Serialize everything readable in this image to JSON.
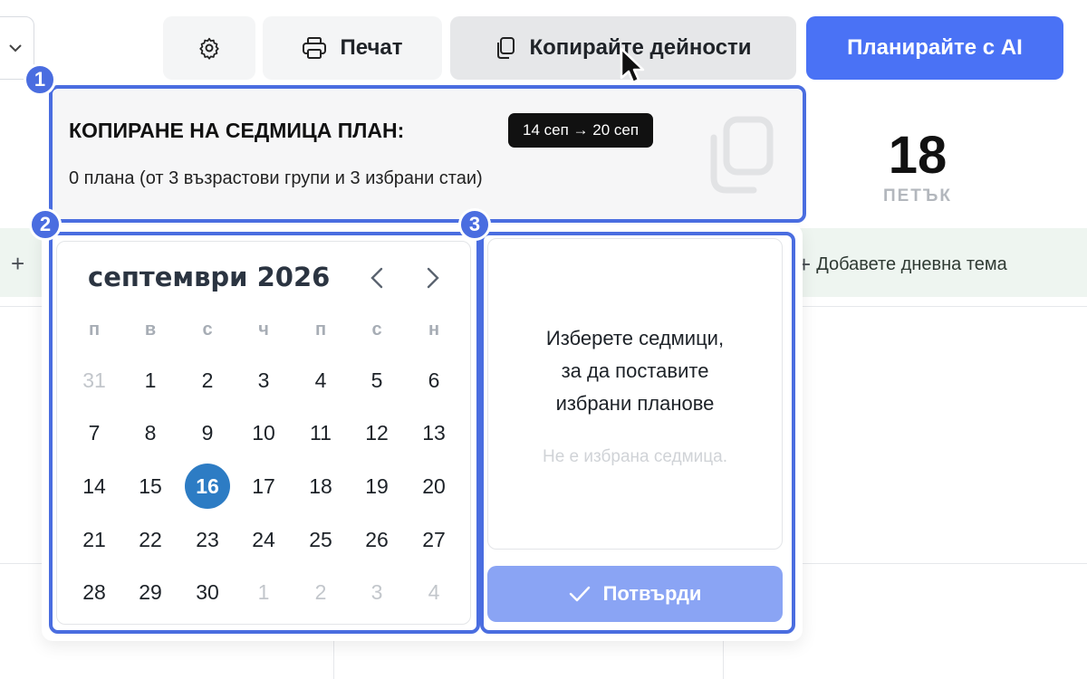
{
  "toolbar": {
    "print_label": "Печат",
    "copy_label": "Копирайте дейности",
    "ai_label": "Планирайте с AI"
  },
  "background": {
    "day_number": "18",
    "day_name": "ПЕТЪК",
    "add_theme_label": "Добавете дневна тема"
  },
  "markers": [
    "1",
    "2",
    "3"
  ],
  "copy_panel": {
    "title": "КОПИРАНЕ НА СЕДМИЦА ПЛАН:",
    "week_badge": "14 сеп → 20 сеп",
    "summary": "0 плана (от 3 възрастови групи и 3 избрани стаи)"
  },
  "calendar": {
    "month_label": "септември 2026",
    "weekdays": [
      "п",
      "в",
      "с",
      "ч",
      "п",
      "с",
      "н"
    ],
    "weeks": [
      [
        {
          "d": "31",
          "m": true
        },
        {
          "d": "1"
        },
        {
          "d": "2"
        },
        {
          "d": "3"
        },
        {
          "d": "4"
        },
        {
          "d": "5"
        },
        {
          "d": "6"
        }
      ],
      [
        {
          "d": "7"
        },
        {
          "d": "8"
        },
        {
          "d": "9"
        },
        {
          "d": "10"
        },
        {
          "d": "11"
        },
        {
          "d": "12"
        },
        {
          "d": "13"
        }
      ],
      [
        {
          "d": "14"
        },
        {
          "d": "15"
        },
        {
          "d": "16",
          "sel": true
        },
        {
          "d": "17"
        },
        {
          "d": "18"
        },
        {
          "d": "19"
        },
        {
          "d": "20"
        }
      ],
      [
        {
          "d": "21"
        },
        {
          "d": "22"
        },
        {
          "d": "23"
        },
        {
          "d": "24"
        },
        {
          "d": "25"
        },
        {
          "d": "26"
        },
        {
          "d": "27"
        }
      ],
      [
        {
          "d": "28"
        },
        {
          "d": "29"
        },
        {
          "d": "30"
        },
        {
          "d": "1",
          "m": true
        },
        {
          "d": "2",
          "m": true
        },
        {
          "d": "3",
          "m": true
        },
        {
          "d": "4",
          "m": true
        }
      ]
    ]
  },
  "week_select": {
    "prompt": "Изберете седмици,\nза да поставите\nизбрани планове",
    "empty_text": "Не е избрана седмица."
  },
  "confirm_label": "Потвърди",
  "colors": {
    "accent": "#4a6de0",
    "primary_button": "#4a72f5",
    "selected_day": "#2d7cc4",
    "confirm_disabled": "#8aa4f4"
  }
}
